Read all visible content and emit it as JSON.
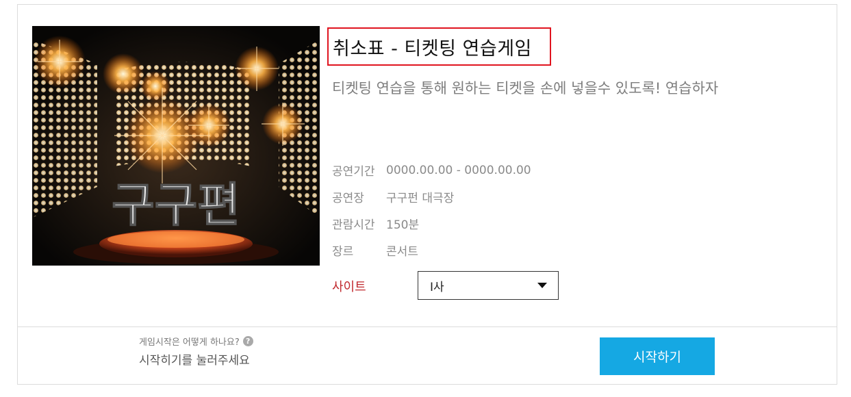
{
  "game": {
    "title": "취소표 - 티켓팅 연습게임",
    "subtitle": "티켓팅 연습을 통해 원하는 티켓을 손에 넣을수 있도록! 연습하자",
    "poster_text": "구구편"
  },
  "info": [
    {
      "label": "공연기간",
      "value": "0000.00.00 - 0000.00.00"
    },
    {
      "label": "공연장",
      "value": "구구펀 대극장"
    },
    {
      "label": "관람시간",
      "value": "150분"
    },
    {
      "label": "장르",
      "value": "콘서트"
    }
  ],
  "site": {
    "label": "사이트",
    "selected": "I사"
  },
  "footer": {
    "help_question": "게임시작은 어떻게 하나요?",
    "help_icon": "?",
    "help_answer": "시작히기를 눌러주세요",
    "start_label": "시작하기"
  },
  "colors": {
    "accent": "#15a8e3",
    "highlight_border": "#e0141f",
    "site_label": "#c0282d"
  }
}
